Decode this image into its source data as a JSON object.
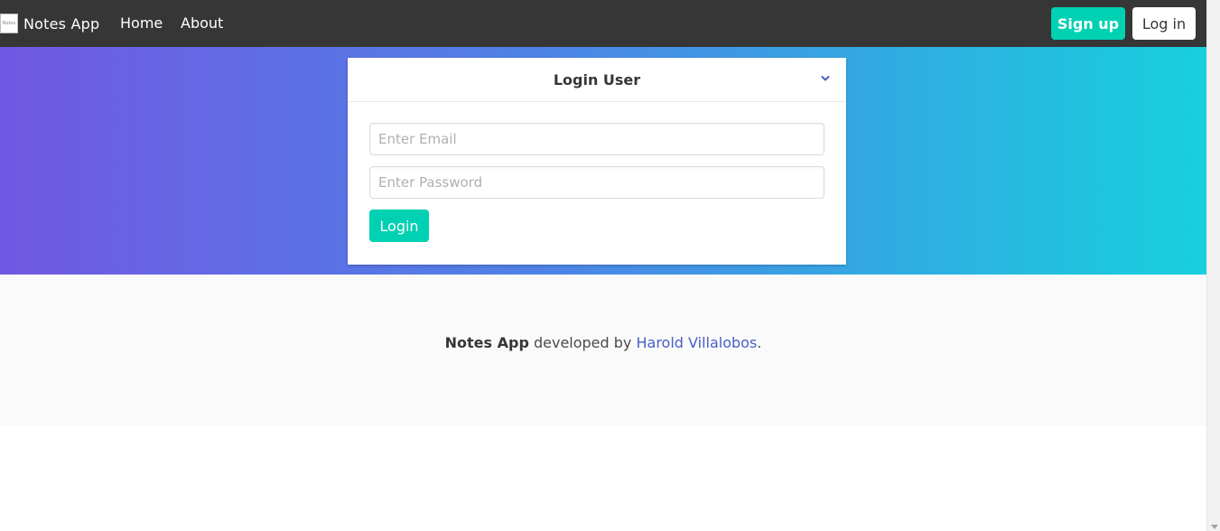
{
  "navbar": {
    "logo_text": "Notes",
    "brand": "Notes App",
    "links": [
      "Home",
      "About"
    ],
    "signup_label": "Sign up",
    "login_label": "Log in"
  },
  "login_card": {
    "title": "Login User",
    "email_placeholder": "Enter Email",
    "password_placeholder": "Enter Password",
    "submit_label": "Login"
  },
  "footer": {
    "app_name": "Notes App",
    "middle_text": " developed by ",
    "author": "Harold Villalobos",
    "end_text": "."
  },
  "colors": {
    "navbar": "#363636",
    "primary": "#00d1b2",
    "gradient_start": "#7158e2",
    "gradient_end": "#17d0de",
    "link": "#485fc7"
  }
}
